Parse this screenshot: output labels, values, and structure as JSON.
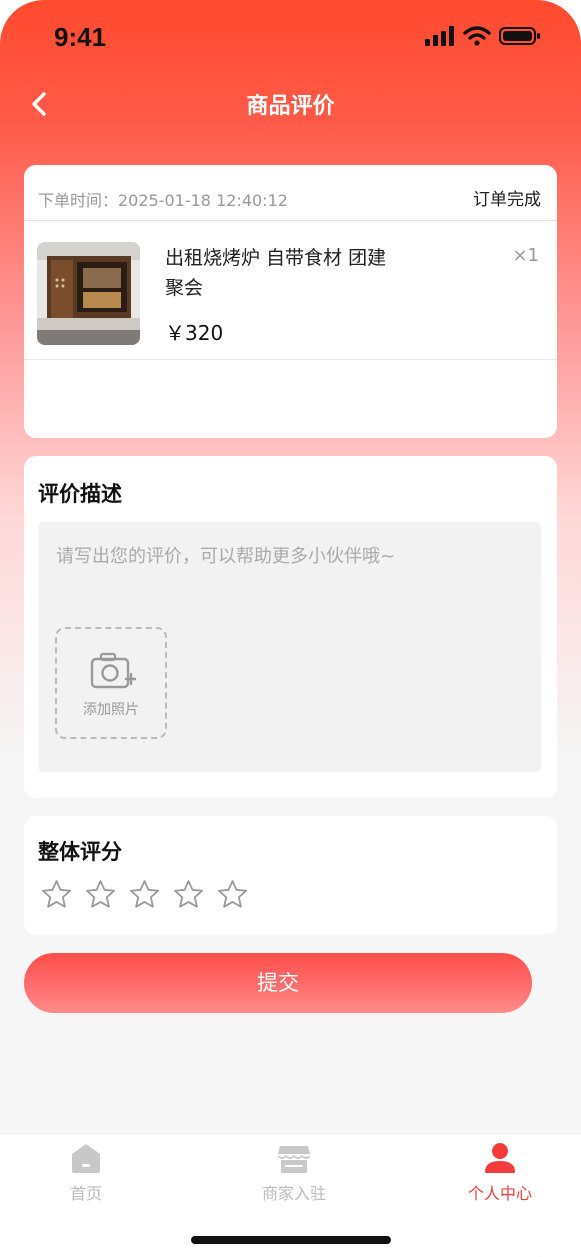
{
  "status_bar": {
    "time": "9:41"
  },
  "nav": {
    "title": "商品评价"
  },
  "order": {
    "time_label": "下单时间：2025-01-18 12:40:12",
    "status": "订单完成",
    "product_name": "出租烧烤炉 自带食材 团建聚会",
    "quantity": "×1",
    "price": "￥320"
  },
  "review": {
    "title": "评价描述",
    "placeholder": "请写出您的评价，可以帮助更多小伙伴哦~",
    "add_photo_label": "添加照片"
  },
  "rating": {
    "title": "整体评分",
    "value": 0,
    "max": 5
  },
  "submit_label": "提交",
  "tabbar": {
    "items": [
      {
        "label": "首页",
        "icon": "home-icon"
      },
      {
        "label": "商家入驻",
        "icon": "store-icon"
      },
      {
        "label": "个人中心",
        "icon": "person-icon",
        "active": true
      }
    ]
  },
  "colors": {
    "accent": "#f23c3c",
    "header_start": "#ff4a2e"
  }
}
